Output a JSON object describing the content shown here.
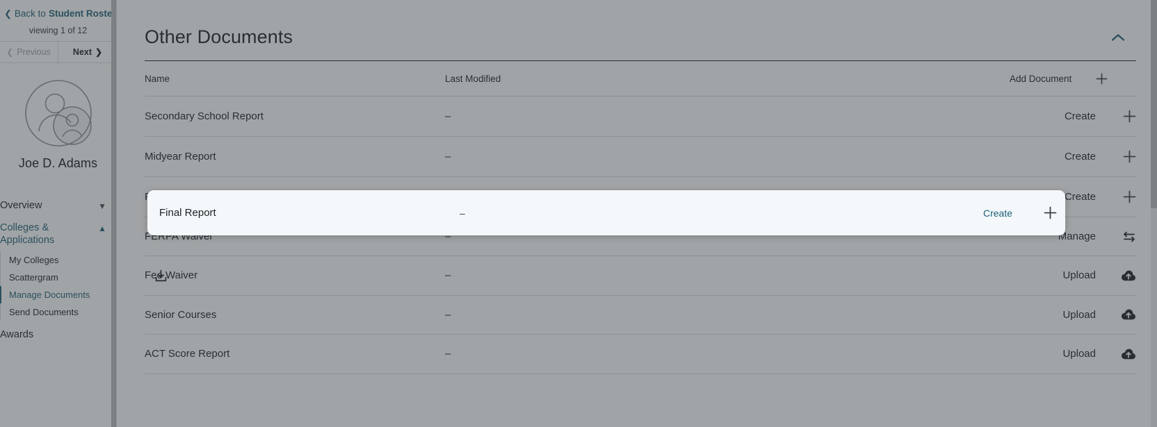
{
  "sidebar": {
    "back_chevron_icon": "chevron-left-icon",
    "back_prefix": "Back to",
    "back_target": "Student Roster",
    "viewing": "viewing 1 of 12",
    "pager": {
      "previous_label": "Previous",
      "next_label": "Next",
      "prev_icon": "chevron-left-icon",
      "next_icon": "chevron-right-icon"
    },
    "avatar_icon": "user-avatar-icon",
    "student_name": "Joe D. Adams",
    "nav": [
      {
        "label": "Overview",
        "expanded": false,
        "chevron_icon": "chevron-down-icon",
        "active": false
      },
      {
        "label": "Colleges & Applications",
        "expanded": true,
        "chevron_icon": "chevron-up-icon",
        "active": true
      }
    ],
    "sub_items": [
      {
        "label": "My Colleges",
        "active": false
      },
      {
        "label": "Scattergram",
        "active": false
      },
      {
        "label": "Manage Documents",
        "active": true
      },
      {
        "label": "Send Documents",
        "active": false
      }
    ],
    "trailing": [
      {
        "label": "Awards"
      }
    ]
  },
  "main": {
    "panel_title": "Other Documents",
    "collapse_icon": "chevron-up-icon",
    "columns": {
      "name": "Name",
      "last_modified": "Last Modified",
      "add_document": "Add Document",
      "add_icon": "plus-icon"
    },
    "rows": [
      {
        "name": "Secondary School Report",
        "last_modified": "–",
        "action": "Create",
        "icon": "plus-icon",
        "gutter_icon": ""
      },
      {
        "name": "Midyear Report",
        "last_modified": "–",
        "action": "Create",
        "icon": "plus-icon",
        "gutter_icon": ""
      },
      {
        "name": "Final Report",
        "last_modified": "–",
        "action": "Create",
        "icon": "plus-icon",
        "gutter_icon": "",
        "highlighted": true
      },
      {
        "name": "FERPA Waiver",
        "last_modified": "–",
        "action": "Manage",
        "icon": "exchange-arrows-icon",
        "gutter_icon": ""
      },
      {
        "name": "Fee Waiver",
        "last_modified": "–",
        "action": "Upload",
        "icon": "cloud-upload-icon",
        "gutter_icon": "download-icon"
      },
      {
        "name": "Senior Courses",
        "last_modified": "–",
        "action": "Upload",
        "icon": "cloud-upload-icon",
        "gutter_icon": ""
      },
      {
        "name": "ACT Score Report",
        "last_modified": "–",
        "action": "Upload",
        "icon": "cloud-upload-icon",
        "gutter_icon": ""
      }
    ],
    "highlight": {
      "name": "Final Report",
      "last_modified": "–",
      "action": "Create",
      "icon": "plus-icon"
    }
  },
  "colors": {
    "accent_teal": "#1f6079",
    "text_dark": "#1b2024",
    "rule": "#d9dcdf",
    "overlay": "rgba(55,62,66,0.47)",
    "spotlight_bg": "#f4f8fa"
  }
}
